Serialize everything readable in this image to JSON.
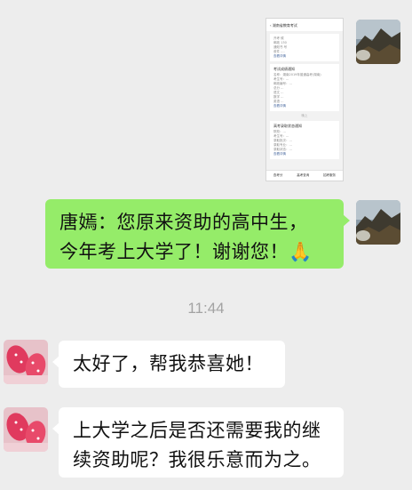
{
  "messages": [
    {
      "sender": "me",
      "type": "image",
      "screenshot": {
        "title": "湖南省教育考试",
        "lines_top": [
          "开考 候",
          "邮政 130",
          "通知书 号",
          "收件 ...."
        ],
        "link_1": "查看详情",
        "card_title": "考试成绩通知",
        "card_lines": [
          "名称：湖南2019年普通高考(湖南)",
          "考生号：...",
          "邮政编号：...",
          "总分 ...",
          "语文 ...",
          "数学 ...",
          "英语 ..."
        ],
        "link_2": "查看详情",
        "time": "晚上",
        "card2_title": "高考录取状态通知",
        "card2_lines": [
          "院校：...",
          "考生号：...",
          "录取批次：...",
          "录取专业：...",
          "录取状态：..."
        ],
        "link_3": "查看详情",
        "tabs": [
          "查考分",
          "高考查询",
          "招考服务"
        ]
      }
    },
    {
      "sender": "me",
      "type": "text",
      "lines": [
        "唐嫣：您原来资助的高中生，",
        "今年考上大学了！谢谢您！🙏"
      ]
    },
    {
      "type": "time",
      "text": "11:44"
    },
    {
      "sender": "them",
      "type": "text",
      "lines": [
        "太好了，帮我恭喜她！"
      ]
    },
    {
      "sender": "them",
      "type": "text",
      "lines": [
        "上大学之后是否还需要我的继",
        "续资助呢？我很乐意而为之。"
      ]
    }
  ],
  "colors": {
    "background": "#ededed",
    "me_bubble": "#95ec69",
    "them_bubble": "#ffffff",
    "time_text": "#a3a3a3"
  }
}
